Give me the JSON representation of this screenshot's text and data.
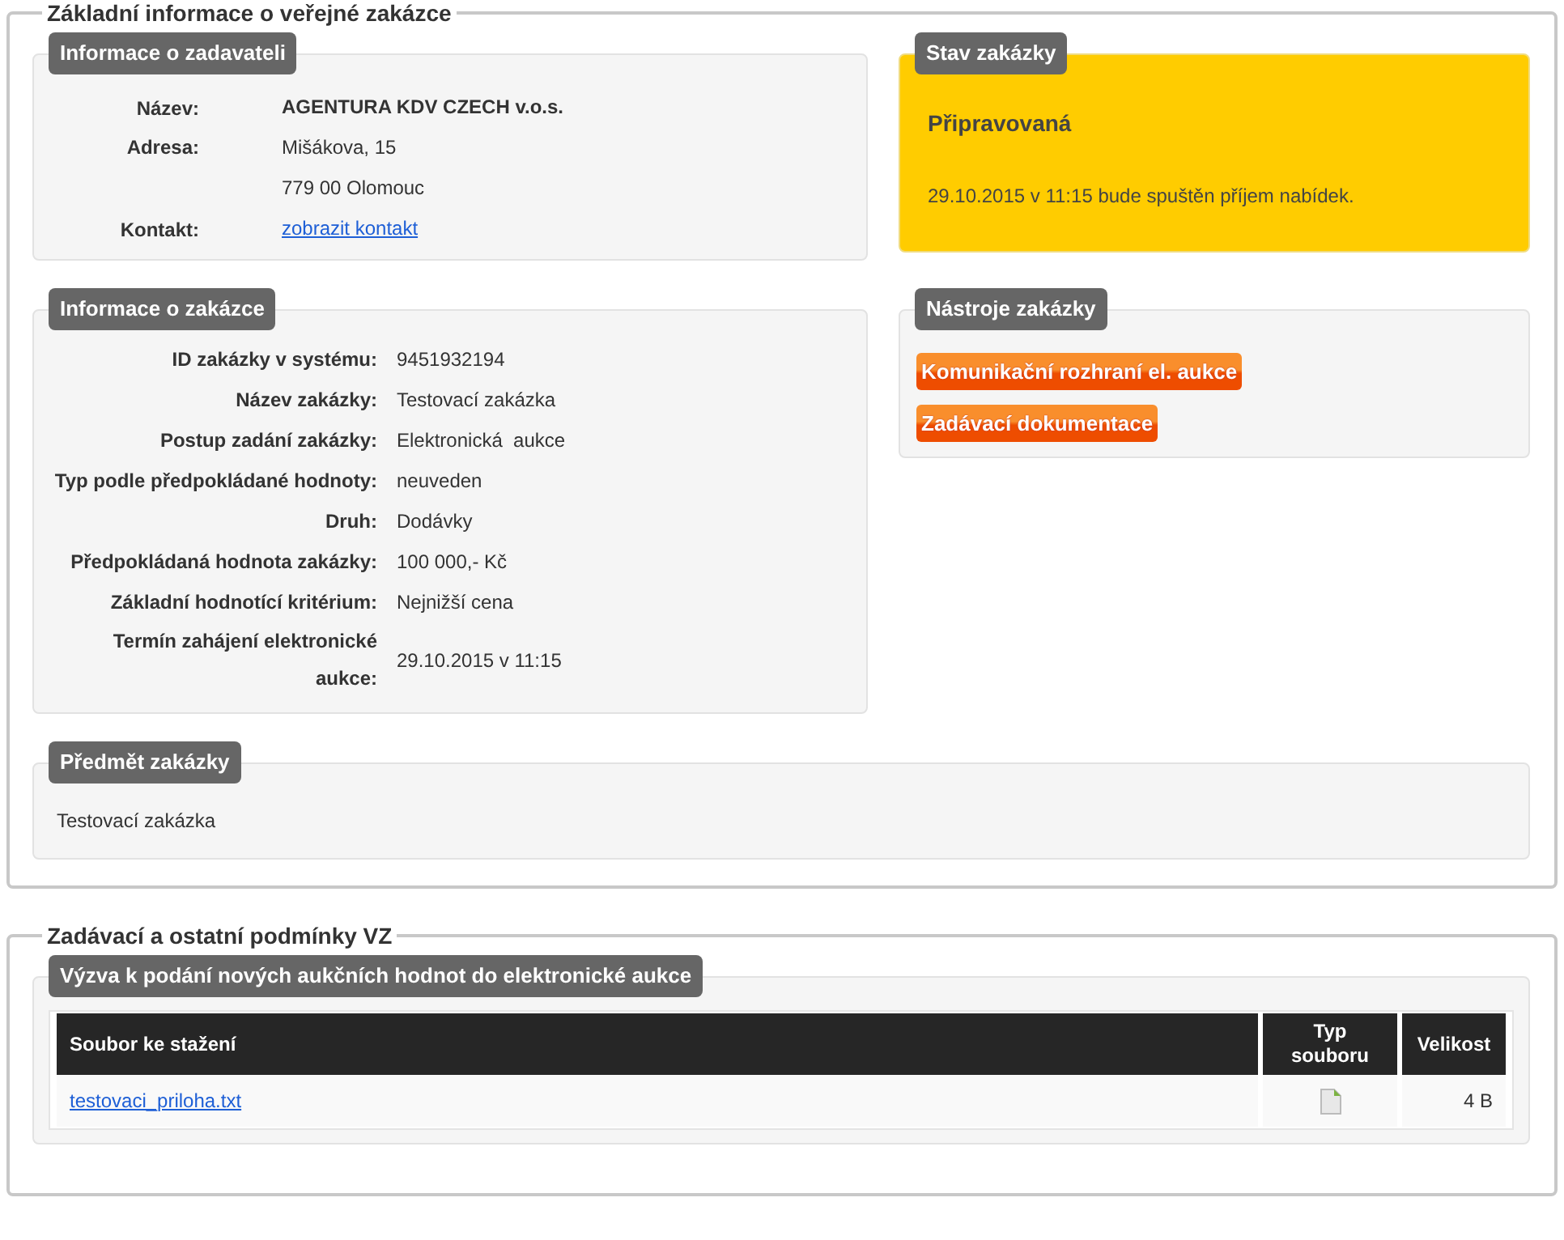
{
  "main_section": {
    "title": "Základní informace o veřejné zakázce",
    "contracting_authority": {
      "title": "Informace o zadavateli",
      "rows": [
        {
          "label": "Název:",
          "kind": "bold",
          "values": [
            "AGENTURA KDV CZECH v.o.s."
          ]
        },
        {
          "label": "Adresa:",
          "kind": "text",
          "values": [
            "Mišákova, 15",
            "779 00 Olomouc"
          ]
        },
        {
          "label": "Kontakt:",
          "kind": "link",
          "values": [
            "zobrazit kontakt"
          ]
        }
      ]
    },
    "status": {
      "title": "Stav zakázky",
      "state": "Připravovaná",
      "note": "29.10.2015 v 11:15 bude spuštěn příjem nabídek."
    },
    "contract_info": {
      "title": "Informace o zakázce",
      "rows": [
        {
          "label": "ID zakázky v systému:",
          "kind": "text",
          "values": [
            "9451932194"
          ]
        },
        {
          "label": "Název zakázky:",
          "kind": "text",
          "values": [
            "Testovací zakázka"
          ]
        },
        {
          "label": "Postup zadání zakázky:",
          "kind": "text",
          "values": [
            "Elektronická  aukce"
          ]
        },
        {
          "label": "Typ podle předpokládané hodnoty:",
          "kind": "text",
          "values": [
            "neuveden"
          ]
        },
        {
          "label": "Druh:",
          "kind": "text",
          "values": [
            "Dodávky"
          ]
        },
        {
          "label": "Předpokládaná hodnota zakázky:",
          "kind": "text",
          "values": [
            "100 000,- Kč"
          ]
        },
        {
          "label": "Základní hodnotící kritérium:",
          "kind": "text",
          "values": [
            "Nejnižší cena"
          ]
        },
        {
          "label": "Termín zahájení elektronické aukce:",
          "kind": "text",
          "values": [
            "29.10.2015 v 11:15"
          ]
        }
      ]
    },
    "tools": {
      "title": "Nástroje zakázky",
      "buttons": [
        "Komunikační rozhraní el. aukce",
        "Zadávací dokumentace"
      ]
    },
    "subject": {
      "title": "Předmět zakázky",
      "text": "Testovací zakázka"
    }
  },
  "conditions_section": {
    "title": "Zadávací a ostatní podmínky VZ",
    "documents": {
      "title": "Výzva k podání nových aukčních hodnot do elektronické aukce",
      "columns": [
        "Soubor ke stažení",
        "Typ souboru",
        "Velikost"
      ],
      "rows": [
        {
          "file": "testovaci_priloha.txt",
          "size": "4 B"
        }
      ]
    }
  }
}
